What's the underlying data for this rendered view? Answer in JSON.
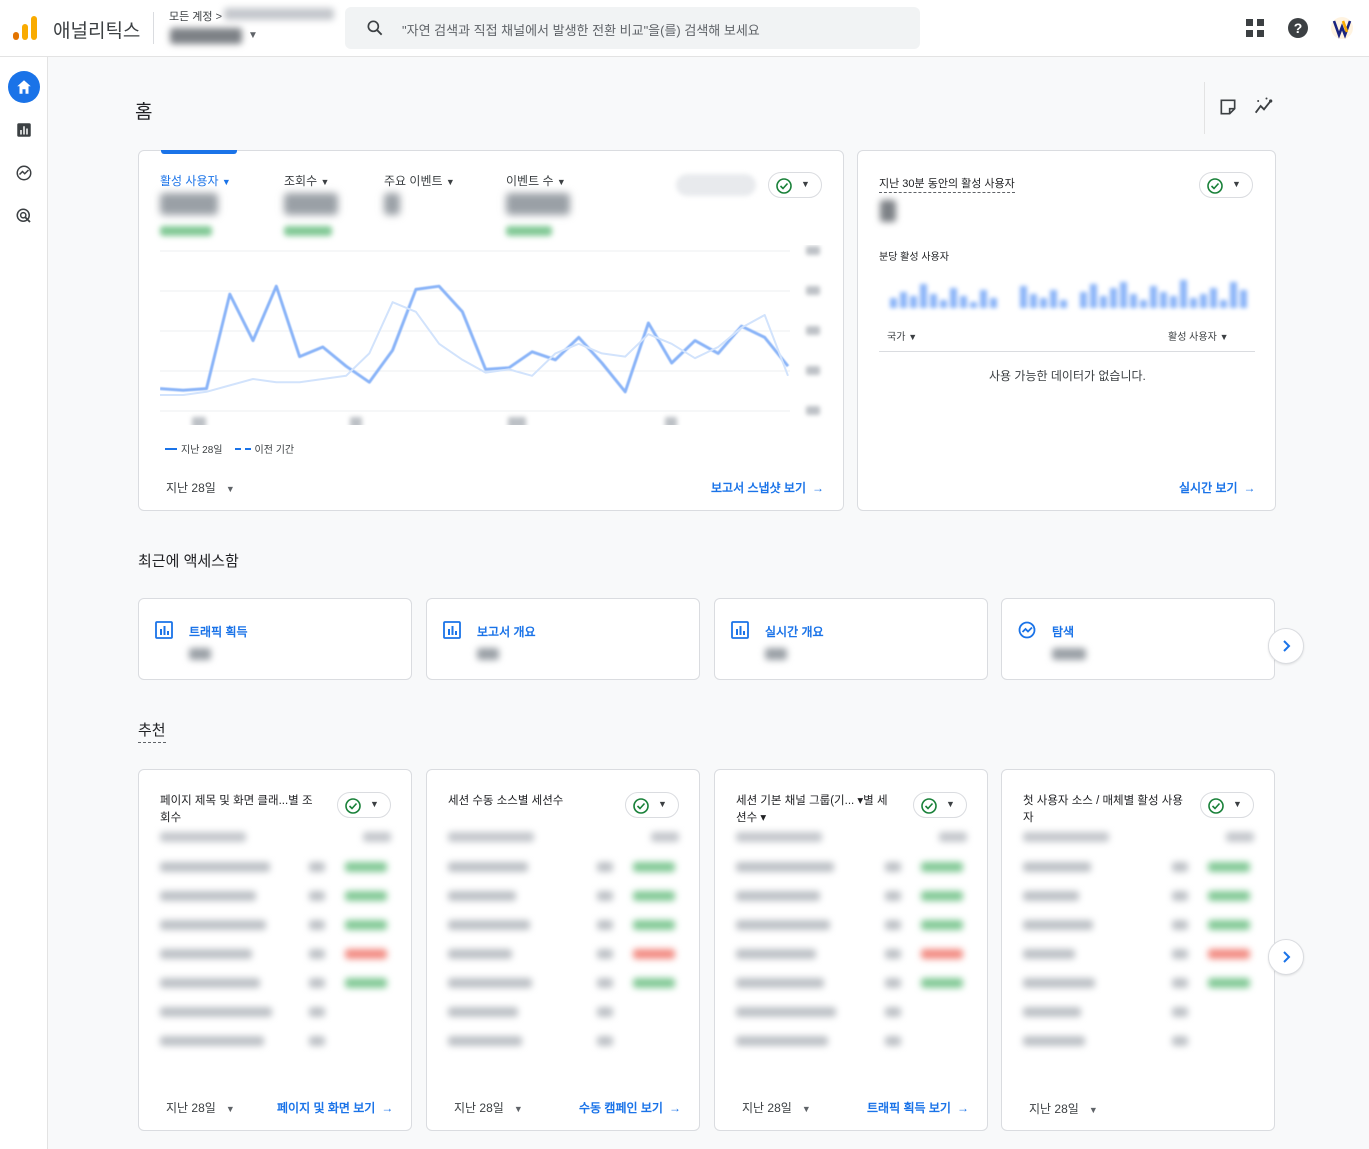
{
  "app": {
    "title": "애널리틱스",
    "account_label": "모든 계정 >"
  },
  "search": {
    "placeholder": "\"자연 검색과 직접 채널에서 발생한 전환 비교\"을(를) 검색해 보세요"
  },
  "top_icons": [
    "apps-grid-icon",
    "help-icon",
    "account-avatar-icon"
  ],
  "sidebar": {
    "items": [
      {
        "name": "home",
        "icon": "home-icon",
        "active": true
      },
      {
        "name": "reports",
        "icon": "bar-chart-icon",
        "active": false
      },
      {
        "name": "explore",
        "icon": "explore-icon",
        "active": false
      },
      {
        "name": "advertising",
        "icon": "advertising-icon",
        "active": false
      }
    ]
  },
  "page": {
    "title": "홈"
  },
  "overview": {
    "tabs": [
      {
        "label": "활성 사용자",
        "active": true
      },
      {
        "label": "조회수",
        "active": false
      },
      {
        "label": "주요 이벤트",
        "active": false
      },
      {
        "label": "이벤트 수",
        "active": false
      }
    ],
    "legend": {
      "current": "지난 28일",
      "previous": "이전 기간"
    },
    "date_range": "지난 28일",
    "link": "보고서 스냅샷 보기"
  },
  "chart_data": {
    "type": "line",
    "title": "",
    "xlabel": "",
    "ylabel": "",
    "ylim": [
      0,
      1
    ],
    "grid": true,
    "note_values": "values normalized; axis tick labels are blurred in source",
    "series": [
      {
        "name": "지난 28일",
        "values": [
          0.14,
          0.13,
          0.14,
          0.73,
          0.44,
          0.78,
          0.34,
          0.4,
          0.28,
          0.18,
          0.38,
          0.76,
          0.78,
          0.62,
          0.26,
          0.27,
          0.37,
          0.32,
          0.46,
          0.3,
          0.12,
          0.55,
          0.3,
          0.44,
          0.36,
          0.53,
          0.46,
          0.28
        ]
      },
      {
        "name": "이전 기간",
        "values": [
          0.1,
          0.1,
          0.12,
          0.16,
          0.2,
          0.18,
          0.18,
          0.2,
          0.22,
          0.36,
          0.68,
          0.62,
          0.42,
          0.32,
          0.24,
          0.26,
          0.22,
          0.36,
          0.42,
          0.36,
          0.34,
          0.48,
          0.42,
          0.33,
          0.4,
          0.52,
          0.6,
          0.22
        ]
      }
    ]
  },
  "realtime": {
    "title": "지난 30분 동안의 활성 사용자",
    "per_minute_label": "분당 활성 사용자",
    "col_country": "국가",
    "col_users": "활성 사용자",
    "empty": "사용 가능한 데이터가 없습니다.",
    "link": "실시간 보기"
  },
  "recent": {
    "title": "최근에 액세스함",
    "items": [
      {
        "label": "트래픽 획득",
        "icon": "report-icon"
      },
      {
        "label": "보고서 개요",
        "icon": "report-icon"
      },
      {
        "label": "실시간 개요",
        "icon": "report-icon"
      },
      {
        "label": "탐색",
        "icon": "explore-icon"
      }
    ]
  },
  "recommend": {
    "title": "추천",
    "cards": [
      {
        "title": "페이지 제목 및 화면 클래...별 조회수",
        "date": "지난 28일",
        "link": "페이지 및 화면 보기"
      },
      {
        "title": "세션 수동 소스별 세션수",
        "date": "지난 28일",
        "link": "수동 캠페인 보기"
      },
      {
        "title": "세션 기본 채널 그룹(기... ▾별 세션수 ▾",
        "date": "지난 28일",
        "link": "트래픽 획득 보기"
      },
      {
        "title": "첫 사용자 소스 / 매체별 활성 사용자",
        "date": "지난 28일",
        "link": ""
      }
    ]
  },
  "colors": {
    "accent": "#1a73e8",
    "success": "#188038",
    "logo_orange": "#f9ab00",
    "logo_dark": "#e37400"
  }
}
